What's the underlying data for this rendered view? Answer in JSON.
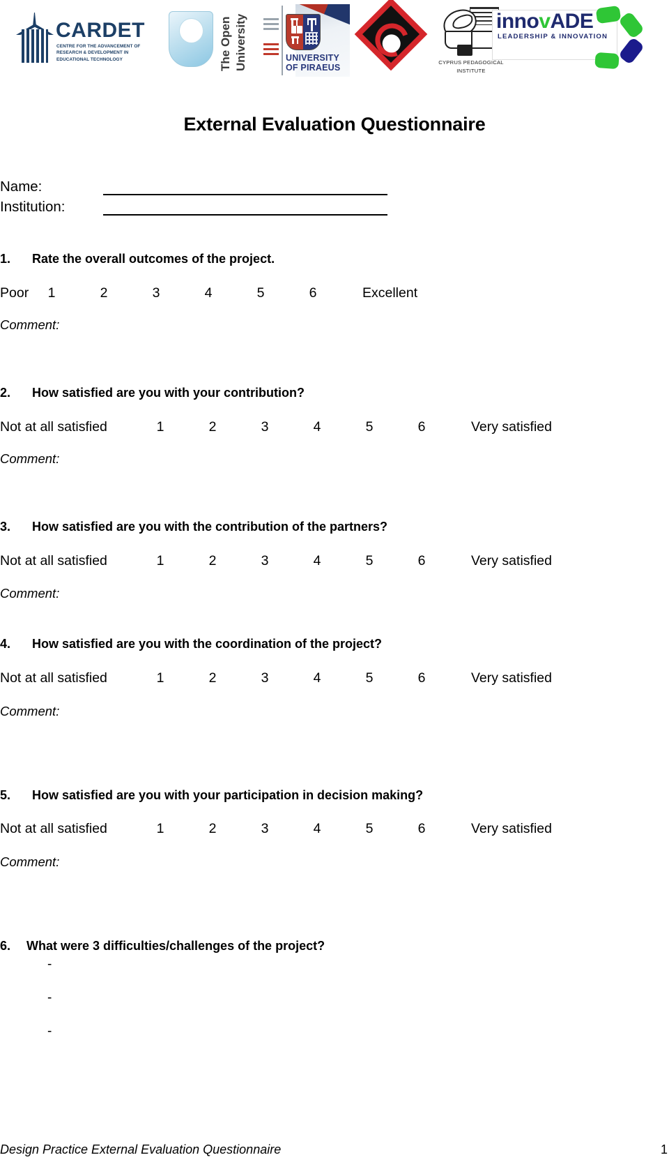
{
  "header": {
    "logos": [
      {
        "name": "cardet",
        "word": "CARDET",
        "tagline": "CENTRE FOR  THE ADVANCEMENT OF RESEARCH & DEVELOPMENT IN EDUCATIONAL TECHNOLOGY",
        "color": "#1c3f66"
      },
      {
        "name": "open-university",
        "line1": "The Open",
        "line2": "University",
        "color": "#8cc7e3"
      },
      {
        "name": "university-of-piraeus",
        "line1": "UNIVERSITY",
        "line2": "OF PIRAEUS",
        "color": "#27377a"
      },
      {
        "name": "red-diamond",
        "color": "#d5262b"
      },
      {
        "name": "cyprus-pedagogical-institute",
        "line1": "CYPRUS PEDAGOGICAL",
        "line2": "INSTITUTE",
        "color": "#1f1f1f"
      },
      {
        "name": "innovade",
        "word_a": "inno",
        "word_v": "v",
        "word_b": "ADE",
        "tagline": "LEADERSHIP & INNOVATION",
        "color": "#1f2a6e",
        "accent": "#2fc636"
      }
    ]
  },
  "document": {
    "title": "External Evaluation Questionnaire",
    "fields": [
      {
        "label": "Name:"
      },
      {
        "label": "Institution:"
      }
    ],
    "comment_label": "Comment:",
    "questions": [
      {
        "number": "1.",
        "text": "Rate the overall outcomes of the project.",
        "scale_low": "Poor",
        "scale_high": "Excellent",
        "scale_values": [
          "1",
          "2",
          "3",
          "4",
          "5",
          "6"
        ]
      },
      {
        "number": "2.",
        "text": "How satisfied are you with your contribution?",
        "scale_low": "Not at all satisfied",
        "scale_high": "Very satisfied",
        "scale_values": [
          "1",
          "2",
          "3",
          "4",
          "5",
          "6"
        ]
      },
      {
        "number": "3.",
        "text": "How satisfied are you with the contribution of the partners?",
        "scale_low": "Not at all satisfied",
        "scale_high": "Very satisfied",
        "scale_values": [
          "1",
          "2",
          "3",
          "4",
          "5",
          "6"
        ]
      },
      {
        "number": "4.",
        "text": "How satisfied are you with the coordination of the project?",
        "scale_low": "Not at all satisfied",
        "scale_high": "Very satisfied",
        "scale_values": [
          "1",
          "2",
          "3",
          "4",
          "5",
          "6"
        ]
      },
      {
        "number": "5.",
        "text": "How satisfied are you with your participation in decision making?",
        "scale_low": "Not at all satisfied",
        "scale_high": "Very satisfied",
        "scale_values": [
          "1",
          "2",
          "3",
          "4",
          "5",
          "6"
        ]
      },
      {
        "number": "6.",
        "text": "What were 3 difficulties/challenges of the project?",
        "bullets": [
          "-",
          "-",
          "-"
        ]
      }
    ]
  },
  "footer": {
    "text": "Design Practice External Evaluation Questionnaire",
    "page": "1"
  }
}
